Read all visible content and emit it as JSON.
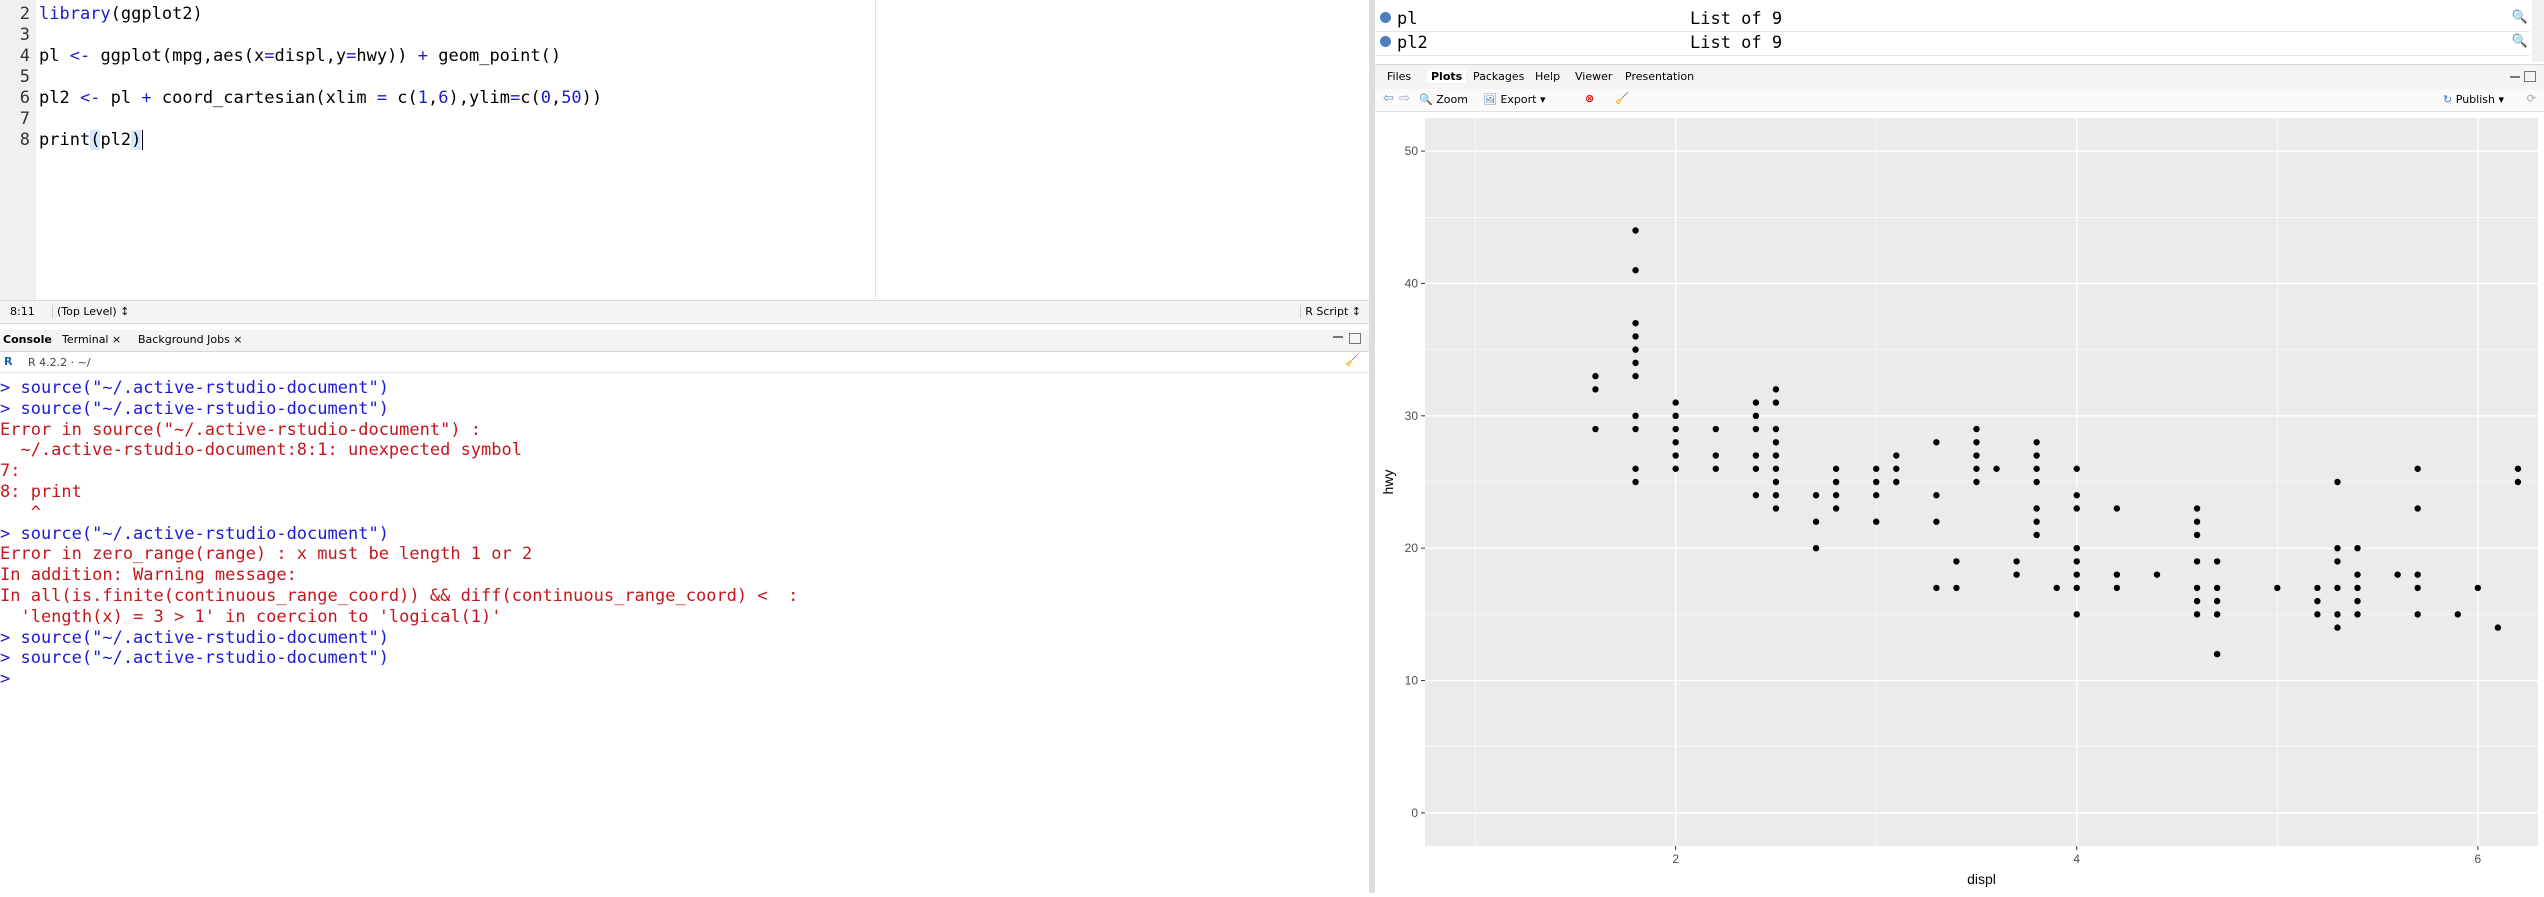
{
  "editor": {
    "line_numbers": [
      "2",
      "3",
      "4",
      "5",
      "6",
      "7",
      "8"
    ],
    "cursor_position": "8:11",
    "scope": "(Top Level) ↕",
    "file_type": "R Script ↕"
  },
  "console": {
    "tabs": [
      "Console",
      "Terminal ×",
      "Background Jobs ×"
    ],
    "r_version": "R 4.2.2 · ~/",
    "lines": [
      {
        "text": "> source(\"~/.active-rstudio-document\")",
        "kind": "cmd"
      },
      {
        "text": "> source(\"~/.active-rstudio-document\")",
        "kind": "cmd"
      },
      {
        "text": "Error in source(\"~/.active-rstudio-document\") :",
        "kind": "err"
      },
      {
        "text": "  ~/.active-rstudio-document:8:1: unexpected symbol",
        "kind": "err"
      },
      {
        "text": "7:",
        "kind": "err"
      },
      {
        "text": "8: print",
        "kind": "err"
      },
      {
        "text": "   ^",
        "kind": "err"
      },
      {
        "text": "> source(\"~/.active-rstudio-document\")",
        "kind": "cmd"
      },
      {
        "text": "Error in zero_range(range) : x must be length 1 or 2",
        "kind": "err"
      },
      {
        "text": "In addition: Warning message:",
        "kind": "err"
      },
      {
        "text": "In all(is.finite(continuous_range_coord)) && diff(continuous_range_coord) <  :",
        "kind": "err"
      },
      {
        "text": "  'length(x) = 3 > 1' in coercion to 'logical(1)'",
        "kind": "err"
      },
      {
        "text": "> source(\"~/.active-rstudio-document\")",
        "kind": "cmd"
      },
      {
        "text": "> source(\"~/.active-rstudio-document\")",
        "kind": "cmd"
      },
      {
        "text": "> ",
        "kind": "cmd"
      }
    ]
  },
  "environment": {
    "rows": [
      {
        "name": "pl",
        "value": "List of  9"
      },
      {
        "name": "pl2",
        "value": "List of  9"
      }
    ]
  },
  "plots_pane": {
    "tabs": [
      "Files",
      "Plots",
      "Packages",
      "Help",
      "Viewer",
      "Presentation"
    ],
    "active_tab": "Plots",
    "toolbar": {
      "zoom": "Zoom",
      "export": "Export ▾",
      "publish": "Publish ▾"
    }
  },
  "colors": {
    "panel_bg": "#ebebeb",
    "grid": "#ffffff",
    "point": "#000000",
    "error_text": "#c4161c",
    "command_text": "#1a1ad6"
  },
  "chart_data": {
    "type": "scatter",
    "xlabel": "displ",
    "ylabel": "hwy",
    "xlim": [
      0.75,
      6.3
    ],
    "ylim": [
      -2.5,
      52.5
    ],
    "x_ticks": [
      2,
      4,
      6
    ],
    "y_ticks": [
      0,
      10,
      20,
      30,
      40,
      50
    ],
    "grid": true,
    "points": [
      [
        1.6,
        33
      ],
      [
        1.6,
        32
      ],
      [
        1.6,
        29
      ],
      [
        1.8,
        44
      ],
      [
        1.8,
        41
      ],
      [
        1.8,
        37
      ],
      [
        1.8,
        36
      ],
      [
        1.8,
        35
      ],
      [
        1.8,
        34
      ],
      [
        1.8,
        33
      ],
      [
        1.8,
        30
      ],
      [
        1.8,
        29
      ],
      [
        1.8,
        26
      ],
      [
        1.8,
        25
      ],
      [
        2.0,
        31
      ],
      [
        2.0,
        30
      ],
      [
        2.0,
        29
      ],
      [
        2.0,
        28
      ],
      [
        2.0,
        27
      ],
      [
        2.0,
        26
      ],
      [
        2.2,
        29
      ],
      [
        2.2,
        27
      ],
      [
        2.2,
        26
      ],
      [
        2.4,
        31
      ],
      [
        2.4,
        30
      ],
      [
        2.4,
        29
      ],
      [
        2.4,
        27
      ],
      [
        2.4,
        26
      ],
      [
        2.4,
        24
      ],
      [
        2.5,
        32
      ],
      [
        2.5,
        31
      ],
      [
        2.5,
        29
      ],
      [
        2.5,
        28
      ],
      [
        2.5,
        27
      ],
      [
        2.5,
        26
      ],
      [
        2.5,
        25
      ],
      [
        2.5,
        24
      ],
      [
        2.5,
        23
      ],
      [
        2.7,
        24
      ],
      [
        2.7,
        22
      ],
      [
        2.7,
        20
      ],
      [
        2.8,
        26
      ],
      [
        2.8,
        25
      ],
      [
        2.8,
        24
      ],
      [
        2.8,
        23
      ],
      [
        3.0,
        26
      ],
      [
        3.0,
        25
      ],
      [
        3.0,
        24
      ],
      [
        3.0,
        22
      ],
      [
        3.1,
        27
      ],
      [
        3.1,
        26
      ],
      [
        3.1,
        25
      ],
      [
        3.3,
        28
      ],
      [
        3.3,
        24
      ],
      [
        3.3,
        22
      ],
      [
        3.3,
        17
      ],
      [
        3.4,
        19
      ],
      [
        3.4,
        17
      ],
      [
        3.5,
        29
      ],
      [
        3.5,
        28
      ],
      [
        3.5,
        27
      ],
      [
        3.5,
        26
      ],
      [
        3.5,
        25
      ],
      [
        3.6,
        26
      ],
      [
        3.7,
        19
      ],
      [
        3.7,
        18
      ],
      [
        3.8,
        28
      ],
      [
        3.8,
        27
      ],
      [
        3.8,
        26
      ],
      [
        3.8,
        25
      ],
      [
        3.8,
        23
      ],
      [
        3.8,
        22
      ],
      [
        3.8,
        21
      ],
      [
        3.9,
        17
      ],
      [
        4.0,
        26
      ],
      [
        4.0,
        24
      ],
      [
        4.0,
        23
      ],
      [
        4.0,
        20
      ],
      [
        4.0,
        19
      ],
      [
        4.0,
        18
      ],
      [
        4.0,
        17
      ],
      [
        4.0,
        15
      ],
      [
        4.2,
        23
      ],
      [
        4.2,
        18
      ],
      [
        4.2,
        17
      ],
      [
        4.4,
        18
      ],
      [
        4.6,
        23
      ],
      [
        4.6,
        22
      ],
      [
        4.6,
        21
      ],
      [
        4.6,
        19
      ],
      [
        4.6,
        17
      ],
      [
        4.6,
        16
      ],
      [
        4.6,
        15
      ],
      [
        4.7,
        19
      ],
      [
        4.7,
        17
      ],
      [
        4.7,
        16
      ],
      [
        4.7,
        15
      ],
      [
        4.7,
        12
      ],
      [
        5.0,
        17
      ],
      [
        5.2,
        17
      ],
      [
        5.2,
        16
      ],
      [
        5.2,
        15
      ],
      [
        5.3,
        25
      ],
      [
        5.3,
        20
      ],
      [
        5.3,
        19
      ],
      [
        5.3,
        17
      ],
      [
        5.3,
        15
      ],
      [
        5.3,
        14
      ],
      [
        5.4,
        20
      ],
      [
        5.4,
        18
      ],
      [
        5.4,
        17
      ],
      [
        5.4,
        16
      ],
      [
        5.4,
        15
      ],
      [
        5.6,
        18
      ],
      [
        5.7,
        26
      ],
      [
        5.7,
        23
      ],
      [
        5.7,
        18
      ],
      [
        5.7,
        17
      ],
      [
        5.7,
        15
      ],
      [
        5.9,
        15
      ],
      [
        6.0,
        17
      ],
      [
        6.1,
        14
      ],
      [
        6.2,
        26
      ],
      [
        6.2,
        25
      ]
    ]
  }
}
